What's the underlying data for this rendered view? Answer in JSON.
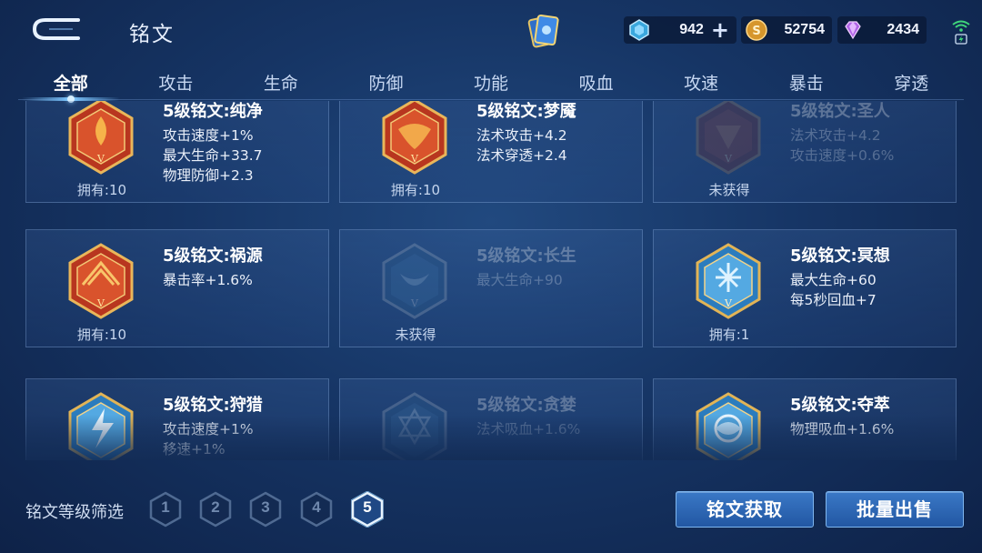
{
  "header": {
    "title": "铭文",
    "back_icon": "back-arrow-icon",
    "card_pack_icon": "card-pack-icon"
  },
  "currencies": [
    {
      "name": "diamond",
      "icon": "diamond-icon",
      "value": "942",
      "has_plus": true,
      "color": "#4fb9e8"
    },
    {
      "name": "gold",
      "icon": "gold-coin-icon",
      "value": "52754",
      "color": "#e0a63a"
    },
    {
      "name": "gem",
      "icon": "purple-gem-icon",
      "value": "2434",
      "color": "#b86ce8"
    }
  ],
  "status": {
    "wifi_icon": "wifi-icon",
    "battery_icon": "battery-charging-icon"
  },
  "tabs": [
    {
      "label": "全部",
      "active": true
    },
    {
      "label": "攻击"
    },
    {
      "label": "生命"
    },
    {
      "label": "防御"
    },
    {
      "label": "功能"
    },
    {
      "label": "吸血"
    },
    {
      "label": "攻速"
    },
    {
      "label": "暴击"
    },
    {
      "label": "穿透"
    }
  ],
  "cards": [
    {
      "title": "5级铭文:纯净",
      "stats": [
        "攻击速度+1%",
        "最大生命+33.7",
        "物理防御+2.3"
      ],
      "owned": "拥有:10",
      "owned_state": "owned",
      "theme": "red"
    },
    {
      "title": "5级铭文:梦魇",
      "stats": [
        "法术攻击+4.2",
        "法术穿透+2.4"
      ],
      "owned": "拥有:10",
      "owned_state": "owned",
      "theme": "red"
    },
    {
      "title": "5级铭文:圣人",
      "stats": [
        "法术攻击+4.2",
        "攻击速度+0.6%"
      ],
      "owned": "未获得",
      "owned_state": "locked",
      "theme": "red"
    },
    {
      "title": "5级铭文:祸源",
      "stats": [
        "暴击率+1.6%"
      ],
      "owned": "拥有:10",
      "owned_state": "owned",
      "theme": "red"
    },
    {
      "title": "5级铭文:长生",
      "stats": [
        "最大生命+90"
      ],
      "owned": "未获得",
      "owned_state": "locked",
      "theme": "blue"
    },
    {
      "title": "5级铭文:冥想",
      "stats": [
        "最大生命+60",
        "每5秒回血+7"
      ],
      "owned": "拥有:1",
      "owned_state": "owned",
      "theme": "blue"
    },
    {
      "title": "5级铭文:狩猎",
      "stats": [
        "攻击速度+1%",
        "移速+1%"
      ],
      "owned": "",
      "owned_state": "owned",
      "theme": "blue"
    },
    {
      "title": "5级铭文:贪婪",
      "stats": [
        "法术吸血+1.6%"
      ],
      "owned": "",
      "owned_state": "locked",
      "theme": "blue"
    },
    {
      "title": "5级铭文:夺萃",
      "stats": [
        "物理吸血+1.6%"
      ],
      "owned": "",
      "owned_state": "owned",
      "theme": "blue"
    }
  ],
  "footer": {
    "filter_label": "铭文等级筛选",
    "levels": [
      "1",
      "2",
      "3",
      "4",
      "5"
    ],
    "active_level": "5",
    "obtain_label": "铭文获取",
    "sell_label": "批量出售"
  },
  "colors": {
    "accent_blue": "#3a78c6",
    "tab_glow": "#7cc6ff",
    "red_rune": "#d8492a",
    "blue_rune": "#4fa8e0",
    "gold_frame": "#e2b456"
  }
}
